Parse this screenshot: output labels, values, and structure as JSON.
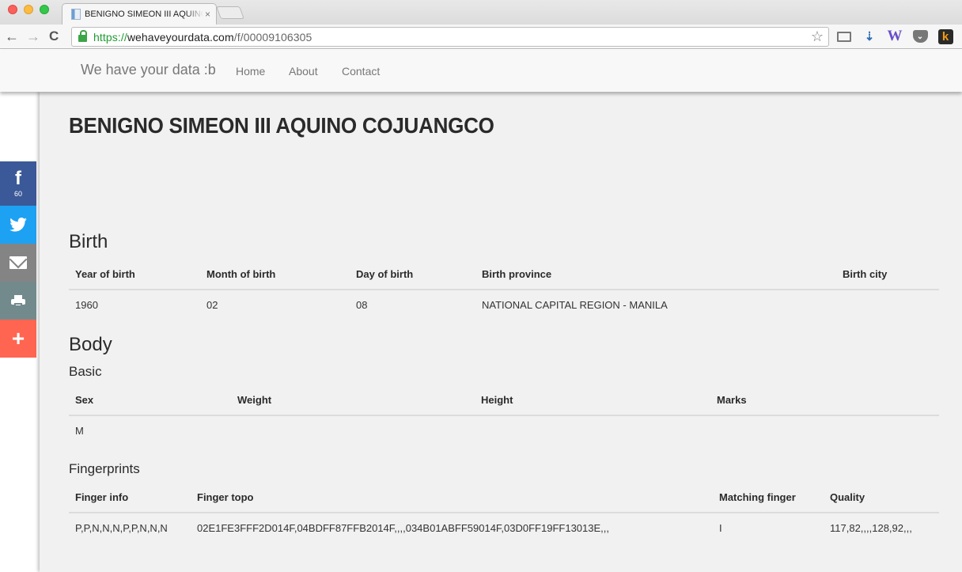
{
  "browser": {
    "tab_title": "BENIGNO SIMEON III AQUINO COJUANGCO",
    "url_scheme": "https://",
    "url_host": "wehaveyourdata.com",
    "url_path": "/f/00009106305",
    "icons": {
      "back": "←",
      "forward": "→",
      "reload": "C",
      "star": "☆",
      "download_ext": "⇣",
      "w_ext": "W",
      "pocket_ext": "⌄",
      "k_ext": "k",
      "close_tab": "×"
    }
  },
  "nav": {
    "brand": "We have your data :b",
    "links": [
      "Home",
      "About",
      "Contact"
    ]
  },
  "share": {
    "facebook_icon": "f",
    "facebook_count": "60",
    "twitter_icon": "🐦",
    "plus_icon": "+",
    "colors": {
      "facebook": "#3b5998",
      "twitter": "#1da1f2",
      "email": "#848484",
      "print": "#738a8d",
      "more": "#ff6550"
    }
  },
  "person": {
    "name": "BENIGNO SIMEON III AQUINO COJUANGCO"
  },
  "birth": {
    "heading": "Birth",
    "columns": [
      "Year of birth",
      "Month of birth",
      "Day of birth",
      "Birth province",
      "Birth city"
    ],
    "row": [
      "1960",
      "02",
      "08",
      "NATIONAL CAPITAL REGION - MANILA",
      ""
    ]
  },
  "body": {
    "heading": "Body",
    "basic": {
      "heading": "Basic",
      "columns": [
        "Sex",
        "Weight",
        "Height",
        "Marks"
      ],
      "row": [
        "M",
        "",
        "",
        ""
      ]
    },
    "fingerprints": {
      "heading": "Fingerprints",
      "columns": [
        "Finger info",
        "Finger topo",
        "Matching finger",
        "Quality"
      ],
      "row": [
        "P,P,N,N,N,P,P,N,N,N",
        "02E1FE3FFF2D014F,04BDFF87FFB2014F,,,,034B01ABFF59014F,03D0FF19FF13013E,,,",
        "I",
        "117,82,,,,128,92,,,"
      ]
    }
  }
}
